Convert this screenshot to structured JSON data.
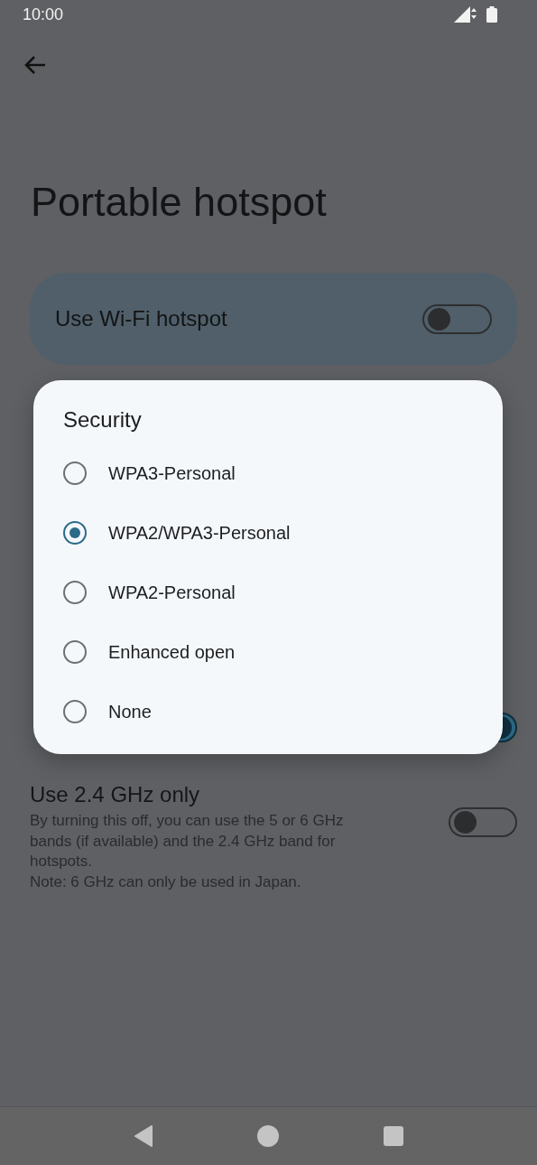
{
  "status_bar": {
    "time": "10:00"
  },
  "title": "Portable hotspot",
  "main_toggle": {
    "label": "Use Wi-Fi hotspot",
    "on": false
  },
  "switch_behind_dialog": {
    "on": true
  },
  "band_setting": {
    "title": "Use 2.4 GHz only",
    "description": "By turning this off, you can use the 5 or 6 GHz bands (if available) and the 2.4 GHz band for hotspots.\nNote: 6 GHz can only be used in Japan.",
    "on": false
  },
  "dialog": {
    "title": "Security",
    "options": [
      {
        "label": "WPA3-Personal",
        "selected": false
      },
      {
        "label": "WPA2/WPA3-Personal",
        "selected": true
      },
      {
        "label": "WPA2-Personal",
        "selected": false
      },
      {
        "label": "Enhanced open",
        "selected": false
      },
      {
        "label": "None",
        "selected": false
      }
    ]
  }
}
